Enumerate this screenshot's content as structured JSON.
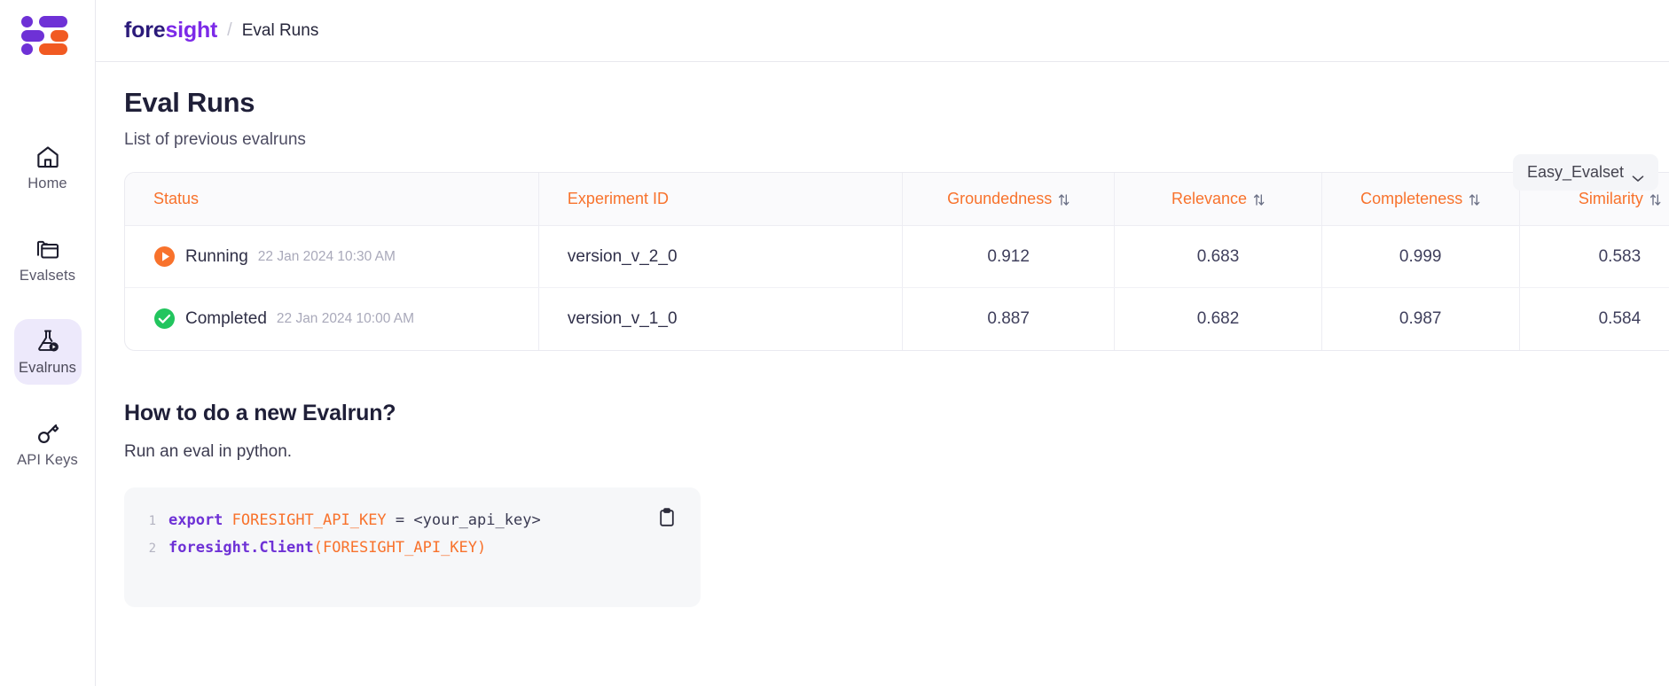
{
  "colors": {
    "accent_orange": "#f8722c",
    "accent_purple": "#7c2ae8",
    "brand_dark": "#2b1a7a",
    "status_running": "#f8722c",
    "status_completed": "#22c55e",
    "sidebar_active_bg": "#ede9fb"
  },
  "sidebar": {
    "logo_name": "foresight-logo-mark",
    "items": [
      {
        "label": "Home",
        "icon": "home-icon",
        "active": false
      },
      {
        "label": "Evalsets",
        "icon": "folders-icon",
        "active": false
      },
      {
        "label": "Evalruns",
        "icon": "flask-play-icon",
        "active": true
      },
      {
        "label": "API Keys",
        "icon": "key-icon",
        "active": false
      }
    ]
  },
  "topbar": {
    "brand_first": "fore",
    "brand_second": "sight",
    "separator": "/",
    "breadcrumb_current": "Eval Runs"
  },
  "page": {
    "title": "Eval Runs",
    "subtitle": "List of previous evalruns"
  },
  "evalset_select": {
    "value": "Easy_Evalset",
    "chevron": "chevron-down-icon"
  },
  "table": {
    "columns": [
      {
        "label": "Status",
        "sortable": false,
        "align": "left"
      },
      {
        "label": "Experiment ID",
        "sortable": false,
        "align": "left"
      },
      {
        "label": "Groundedness",
        "sortable": true,
        "align": "center"
      },
      {
        "label": "Relevance",
        "sortable": true,
        "align": "center"
      },
      {
        "label": "Completeness",
        "sortable": true,
        "align": "center"
      },
      {
        "label": "Similarity",
        "sortable": true,
        "align": "center"
      }
    ],
    "rows": [
      {
        "status": "Running",
        "status_icon": "play-circle-icon",
        "timestamp": "22 Jan 2024 10:30 AM",
        "experiment_id": "version_v_2_0",
        "groundedness": "0.912",
        "relevance": "0.683",
        "completeness": "0.999",
        "similarity": "0.583"
      },
      {
        "status": "Completed",
        "status_icon": "check-circle-icon",
        "timestamp": "22 Jan 2024 10:00 AM",
        "experiment_id": "version_v_1_0",
        "groundedness": "0.887",
        "relevance": "0.682",
        "completeness": "0.987",
        "similarity": "0.584"
      }
    ]
  },
  "howto": {
    "title": "How to do a new Evalrun?",
    "subtitle": "Run an eval in python.",
    "copy_icon": "clipboard-copy-icon",
    "code_lines": [
      {
        "number": "1",
        "tokens": [
          {
            "text": "export",
            "type": "kw"
          },
          {
            "text": " ",
            "type": "plain"
          },
          {
            "text": "FORESIGHT_API_KEY",
            "type": "var"
          },
          {
            "text": " = ",
            "type": "op"
          },
          {
            "text": "<your_api_key>",
            "type": "plain"
          }
        ]
      },
      {
        "number": "2",
        "tokens": [
          {
            "text": "foresight.Client",
            "type": "fn"
          },
          {
            "text": "(",
            "type": "paren"
          },
          {
            "text": "FORESIGHT_API_KEY",
            "type": "var"
          },
          {
            "text": ")",
            "type": "paren"
          }
        ]
      }
    ]
  }
}
